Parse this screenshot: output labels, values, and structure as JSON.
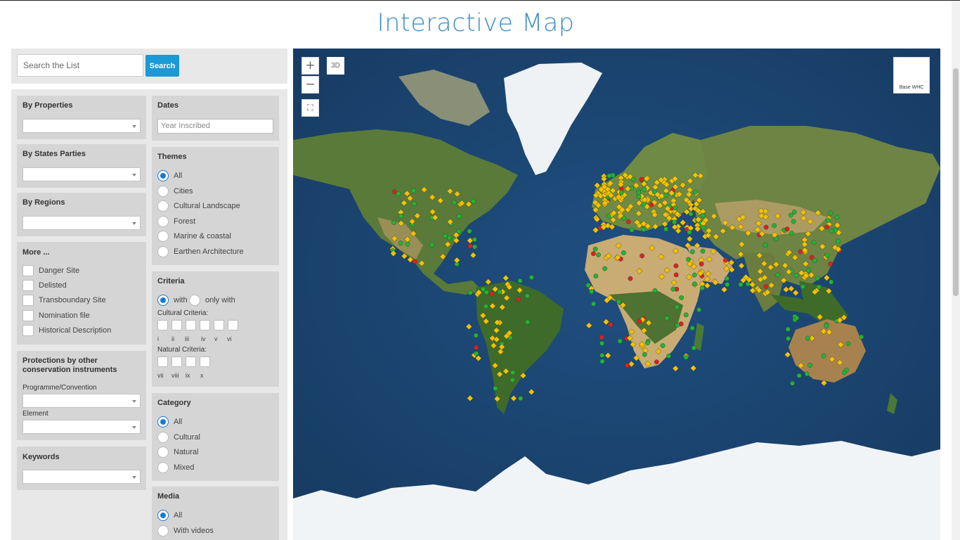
{
  "page": {
    "title": "Interactive Map"
  },
  "search": {
    "placeholder": "Search the List",
    "button_label": "Search"
  },
  "left": {
    "by_properties": "By Properties",
    "by_states_parties": "By States Parties",
    "by_regions": "By Regions",
    "more": {
      "title": "More ...",
      "items": [
        "Danger Site",
        "Delisted",
        "Transboundary Site",
        "Nomination file",
        "Historical Description"
      ]
    },
    "protections": {
      "title": "Protections by other conservation instruments",
      "programme_label": "Programme/Convention",
      "element_label": "Element"
    },
    "keywords": "Keywords"
  },
  "right": {
    "dates": {
      "title": "Dates",
      "placeholder": "Year Inscribed"
    },
    "themes": {
      "title": "Themes",
      "options": [
        "All",
        "Cities",
        "Cultural Landscape",
        "Forest",
        "Marine & coastal",
        "Earthen Architecture"
      ],
      "selected": "All"
    },
    "criteria": {
      "title": "Criteria",
      "mode_with": "with",
      "mode_only_with": "only with",
      "selected_mode": "with",
      "cultural_label": "Cultural Criteria:",
      "cultural": [
        "i",
        "ii",
        "iii",
        "iv",
        "v",
        "vi"
      ],
      "natural_label": "Natural Criteria:",
      "natural": [
        "vii",
        "viii",
        "ix",
        "x"
      ]
    },
    "category": {
      "title": "Category",
      "options": [
        "All",
        "Cultural",
        "Natural",
        "Mixed"
      ],
      "selected": "All"
    },
    "media": {
      "title": "Media",
      "options": [
        "All",
        "With videos"
      ],
      "selected": "All"
    }
  },
  "map": {
    "zoom_in_icon": "plus-icon",
    "zoom_out_icon": "minus-icon",
    "fullscreen_icon": "expand-icon",
    "view_3d_label": "3D",
    "basemap_label": "Base WHC",
    "marker_colors": {
      "cultural": "#f2c200",
      "natural": "#1fb532",
      "danger": "#e02020"
    }
  }
}
